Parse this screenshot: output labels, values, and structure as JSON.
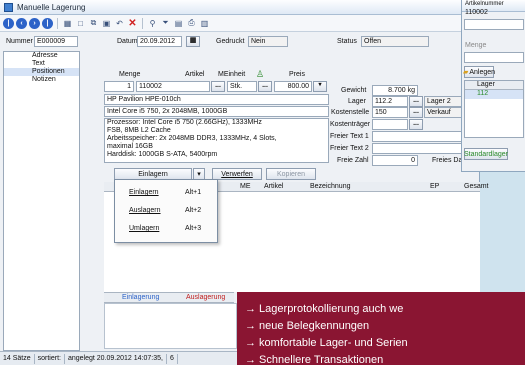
{
  "window": {
    "title": "Manuelle Lagerung"
  },
  "toolbar": {
    "buttons": [
      "first-icon",
      "prev-icon",
      "next-icon",
      "last-icon",
      "grid-icon",
      "new-icon",
      "copy-icon",
      "save-icon",
      "undo-icon",
      "delete-icon",
      "filter-icon",
      "funnel-icon",
      "doc-icon",
      "print-icon",
      "note-icon"
    ]
  },
  "header": {
    "nummer_label": "Nummer",
    "nummer_value": "E000009",
    "datum_label": "Datum",
    "datum_value": "20.09.2012",
    "gedruckt_label": "Gedruckt",
    "gedruckt_value": "Nein",
    "status_label": "Status",
    "status_value": "Offen"
  },
  "sidebar": {
    "items": [
      {
        "label": "Adresse"
      },
      {
        "label": "Text"
      },
      {
        "label": "Positionen"
      },
      {
        "label": "Notizen"
      }
    ]
  },
  "position": {
    "menge_label": "Menge",
    "artikel_label": "Artikel",
    "meinheit_label": "MEinheit",
    "preis_label": "Preis",
    "menge_value": "1",
    "artikel_value": "110002",
    "meinheit_value": "Stk.",
    "preis_value": "800.00",
    "name": "HP Pavilion HPE-010ch",
    "short": "Intel Core i5 750, 2x 2048MB, 1000GB",
    "desc1": "Prozessor:   Intel Core i5 750 (2.66GHz), 1333MHz",
    "desc2": "FSB, 8MB L2 Cache",
    "desc3": "Arbeitsspeicher:   2x 2048MB DDR3, 1333MHz, 4 Slots,",
    "desc4": "maximal 16GB",
    "desc5": "Harddisk:   1000GB S-ATA, 5400rpm",
    "gewicht_label": "Gewicht",
    "gewicht_value": "8.700 kg",
    "lager_label": "Lager",
    "lager_value": "112.2",
    "lager_name": "Lager 2",
    "kst_label": "Kostenstelle",
    "kst_value": "150",
    "kst_name": "Verkauf",
    "kt_label": "Kostenträger",
    "ft1_label": "Freier Text 1",
    "ft2_label": "Freier Text 2",
    "fz_label": "Freie Zahl",
    "fz_value": "0",
    "fd_label": "Freies Da"
  },
  "actions": {
    "einlagern": "Einlagern",
    "verwerfen": "Verwerfen",
    "kopieren": "Kopieren"
  },
  "menu": {
    "items": [
      {
        "label": "Einlagern",
        "shortcut": "Alt+1"
      },
      {
        "label": "Auslagern",
        "shortcut": "Alt+2"
      },
      {
        "label": "Umlagern",
        "shortcut": "Alt+3"
      }
    ]
  },
  "grid": {
    "columns": [
      "ME",
      "Artikel",
      "Bezeichnung",
      "EP",
      "Gesamt"
    ]
  },
  "lower": {
    "tab1": "Einlagerung",
    "tab2": "Auslagerung"
  },
  "second_window": {
    "artikel_label": "Artikelnummer",
    "artikel_value": "110002",
    "menge_label": "Menge",
    "anlegen": "Anlegen",
    "lager_col": "Lager",
    "lager_value": "112",
    "standard": "Standardlager"
  },
  "statusbar": {
    "count": "14 Sätze",
    "sort": "sortiert:",
    "created": "angelegt 20.09.2012 14:07:35,",
    "n": "6"
  },
  "banner": {
    "lines": [
      "→ Lagerprotokollierung auch we",
      "→ neue Belegkennungen",
      "→ komfortable Lager- und Serien",
      "→ Schnellere Transaktionen"
    ]
  },
  "colors": {
    "accent": "#2d63c8",
    "banner": "#8a1532"
  }
}
